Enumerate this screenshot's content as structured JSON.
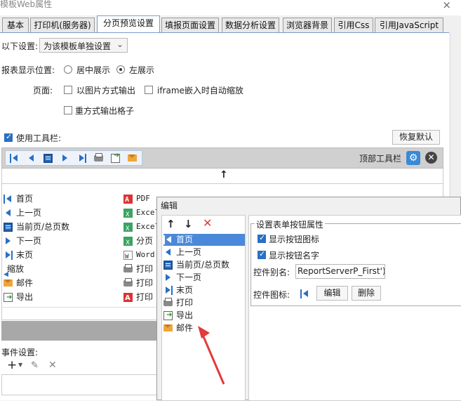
{
  "window": {
    "title": "模板Web属性",
    "close": "×"
  },
  "tabs": [
    {
      "label": "基本"
    },
    {
      "label": "打印机(服务器)"
    },
    {
      "label": "分页预览设置"
    },
    {
      "label": "填报页面设置"
    },
    {
      "label": "数据分析设置"
    },
    {
      "label": "浏览器背景"
    },
    {
      "label": "引用Css"
    },
    {
      "label": "引用JavaScript"
    }
  ],
  "settings": {
    "scope_label": "以下设置:",
    "scope_value": "为该模板单独设置",
    "position_label": "报表显示位置:",
    "position_center": "居中展示",
    "position_left": "左展示",
    "page_label": "页面:",
    "image_mode": "以图片方式输出",
    "iframe_zoom": "iframe嵌入时自动缩放",
    "grid_output": "重方式输出格子",
    "toolbar_label": "使用工具栏:",
    "restore_default": "恢复默认",
    "top_toolbar": "顶部工具栏",
    "move_up_arrow": "↑",
    "event_label": "事件设置:"
  },
  "buttons_col1": [
    {
      "label": "首页",
      "icon": "first-page-icon"
    },
    {
      "label": "上一页",
      "icon": "prev-page-icon"
    },
    {
      "label": "当前页/总页数",
      "icon": "page-count-icon"
    },
    {
      "label": "下一页",
      "icon": "next-page-icon"
    },
    {
      "label": "末页",
      "icon": "last-page-icon"
    },
    {
      "label": "缩放",
      "icon": "zoom-icon"
    },
    {
      "label": "邮件",
      "icon": "mail-icon"
    },
    {
      "label": "导出",
      "icon": "export-icon"
    }
  ],
  "buttons_col2": [
    {
      "label": "PDF",
      "icon": "pdf-icon"
    },
    {
      "label": "Excel",
      "icon": "excel-icon"
    },
    {
      "label": "Excel",
      "icon": "excel-icon"
    },
    {
      "label": "分页",
      "icon": "excel-icon"
    },
    {
      "label": "Word",
      "icon": "word-icon"
    },
    {
      "label": "打印",
      "icon": "print-icon"
    },
    {
      "label": "打印",
      "icon": "print-icon"
    },
    {
      "label": "打印",
      "icon": "pdf-print-icon"
    }
  ],
  "dialog": {
    "title": "编辑",
    "list": [
      {
        "label": "首页",
        "icon": "first-page-icon"
      },
      {
        "label": "上一页",
        "icon": "prev-page-icon"
      },
      {
        "label": "当前页/总页数",
        "icon": "page-count-icon"
      },
      {
        "label": "下一页",
        "icon": "next-page-icon"
      },
      {
        "label": "末页",
        "icon": "last-page-icon"
      },
      {
        "label": "打印",
        "icon": "print-icon"
      },
      {
        "label": "导出",
        "icon": "export-icon"
      },
      {
        "label": "邮件",
        "icon": "mail-icon"
      }
    ],
    "group_title": "设置表单按钮属性",
    "show_icon": "显示按钮图标",
    "show_name": "显示按钮名字",
    "alias_label": "控件别名:",
    "alias_value": "ReportServerP_First')}",
    "icon_label": "控件图标:",
    "edit_button": "编辑",
    "delete_button": "删除"
  },
  "colors": {
    "accent": "#2a6fc4",
    "selection": "#4a89d9",
    "arrow": "#e33a3a"
  }
}
